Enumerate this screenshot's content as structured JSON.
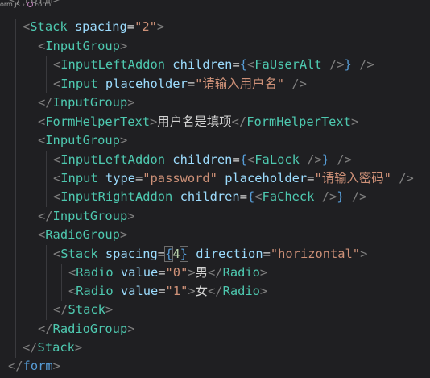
{
  "breadcrumb": {
    "file": "orm.js",
    "separator": "›",
    "symbol": "Form"
  },
  "code": {
    "form_close_partial": "</form>",
    "stack_tag": "Stack",
    "spacing_attr": "spacing",
    "spacing_value": "\"2\"",
    "input_group_tag": "InputGroup",
    "input_left_addon_tag": "InputLeftAddon",
    "children_attr": "children",
    "fa_user_alt": "FaUserAlt",
    "input_tag": "Input",
    "placeholder_attr": "placeholder",
    "username_placeholder": "\"请输入用户名\"",
    "form_helper_text_tag": "FormHelperText",
    "helper_text": "用户名是填项",
    "fa_lock": "FaLock",
    "type_attr": "type",
    "password_value": "\"password\"",
    "password_placeholder": "\"请输入密码\"",
    "input_right_addon_tag": "InputRightAddon",
    "fa_check": "FaCheck",
    "radio_group_tag": "RadioGroup",
    "spacing_num": "4",
    "direction_attr": "direction",
    "direction_value": "\"horizontal\"",
    "radio_tag": "Radio",
    "value_attr": "value",
    "radio0_value": "\"0\"",
    "radio0_label": "男",
    "radio1_value": "\"1\"",
    "radio1_label": "女",
    "form_tag": "form"
  }
}
